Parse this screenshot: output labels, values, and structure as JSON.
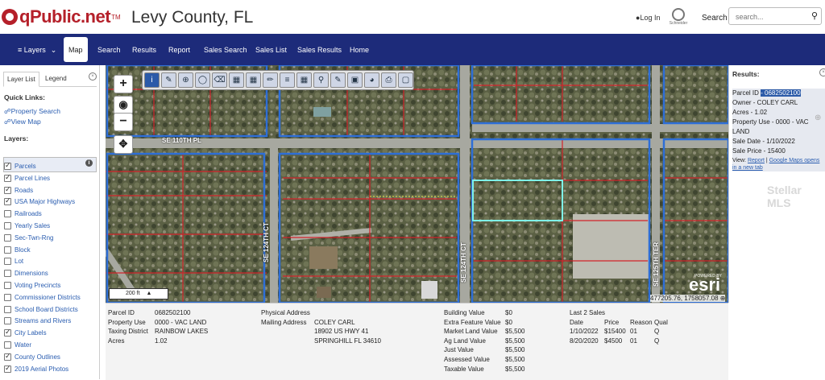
{
  "header": {
    "logo_text": "qPublic.net",
    "logo_tm": "TM",
    "county_title": "Levy County, FL",
    "login_label": "Log In",
    "partner_name": "Schneider",
    "search_label": "Search",
    "search_placeholder": "search..."
  },
  "nav": {
    "items": [
      {
        "label": "Layers",
        "has_dropdown": true
      },
      {
        "label": "Map",
        "active": true
      },
      {
        "label": "Search"
      },
      {
        "label": "Results"
      },
      {
        "label": "Report"
      },
      {
        "label": "Sales Search"
      },
      {
        "label": "Sales List"
      },
      {
        "label": "Sales Results"
      },
      {
        "label": "Home"
      }
    ]
  },
  "sidebar": {
    "tabs": [
      {
        "label": "Layer List",
        "active": true
      },
      {
        "label": "Legend"
      }
    ],
    "quick_links_title": "Quick Links:",
    "quick_links": [
      "Property Search",
      "View Map"
    ],
    "layers_title": "Layers:",
    "layers": [
      {
        "label": "Parcels",
        "checked": true
      },
      {
        "label": "Parcel Lines",
        "checked": true
      },
      {
        "label": "Roads",
        "checked": true
      },
      {
        "label": "USA Major Highways",
        "checked": true
      },
      {
        "label": "Railroads",
        "checked": false
      },
      {
        "label": "Yearly Sales",
        "checked": false
      },
      {
        "label": "Sec-Twn-Rng",
        "checked": false
      },
      {
        "label": "Block",
        "checked": false
      },
      {
        "label": "Lot",
        "checked": false
      },
      {
        "label": "Dimensions",
        "checked": false
      },
      {
        "label": "Voting Precincts",
        "checked": false
      },
      {
        "label": "Commissioner Districts",
        "checked": false
      },
      {
        "label": "School Board Districts",
        "checked": false
      },
      {
        "label": "Streams and Rivers",
        "checked": false
      },
      {
        "label": "City Labels",
        "checked": true
      },
      {
        "label": "Water",
        "checked": false
      },
      {
        "label": "County Outlines",
        "checked": true
      },
      {
        "label": "2019 Aerial Photos",
        "checked": true
      }
    ]
  },
  "map": {
    "zoom_in": "+",
    "zoom_out": "−",
    "toolbar_icons": [
      "info-icon",
      "identify-icon",
      "zoom-in-tool-icon",
      "select-icon",
      "eraser-icon",
      "select-area-icon",
      "table-icon",
      "highlight-icon",
      "layers-icon",
      "grid-icon",
      "find-icon",
      "draw-icon",
      "extent-icon",
      "buffer-icon",
      "print-icon",
      "save-icon"
    ],
    "road_labels": [
      "SE 110TH PL",
      "SE 124TH CT",
      "SE 124TH CT",
      "SE 125TH TER"
    ],
    "scale_label": "200 ft",
    "coordinates": "477205.76, 1758057.08",
    "esri_powered": "POWERED BY",
    "esri_label": "esri"
  },
  "results": {
    "title": "Results:",
    "parcel_id_label": "Parcel ID",
    "parcel_id": "- 0682502100",
    "owner": "Owner - COLEY CARL",
    "acres": "Acres - 1.02",
    "property_use_1": "Property Use - 0000 - VAC",
    "property_use_2": "LAND",
    "sale_date": "Sale Date - 1/10/2022",
    "sale_price": "Sale Price - 15400",
    "view_label": "View:",
    "report_link": "Report",
    "sep": "|",
    "maps_link": "Google Maps opens",
    "maps_link_2": "in a new tab",
    "watermark": "Stellar MLS"
  },
  "details": {
    "parcel_id_label": "Parcel ID",
    "parcel_id": "0682502100",
    "property_use_label": "Property Use",
    "property_use": "0000 - VAC LAND",
    "taxing_district_label": "Taxing District",
    "taxing_district": "RAINBOW LAKES",
    "acres_label": "Acres",
    "acres": "1.02",
    "physical_address_label": "Physical Address",
    "mailing_address_label": "Mailing Address",
    "mailing_name": "COLEY CARL",
    "mailing_line1": "18902 US HWY 41",
    "mailing_line2": "SPRINGHILL FL 34610",
    "values": [
      {
        "label": "Building Value",
        "value": "$0"
      },
      {
        "label": "Extra Feature Value",
        "value": "$0"
      },
      {
        "label": "Market Land Value",
        "value": "$5,500"
      },
      {
        "label": "Ag Land Value",
        "value": "$5,500"
      },
      {
        "label": "Just Value",
        "value": "$5,500"
      },
      {
        "label": "Assessed Value",
        "value": "$5,500"
      },
      {
        "label": "Taxable Value",
        "value": "$5,500"
      }
    ],
    "sales_title": "Last 2 Sales",
    "sales_headers": [
      "Date",
      "Price",
      "Reason",
      "Qual"
    ],
    "sales": [
      [
        "1/10/2022",
        "$15400",
        "01",
        "Q"
      ],
      [
        "8/20/2020",
        "$4500",
        "01",
        "Q"
      ]
    ]
  }
}
